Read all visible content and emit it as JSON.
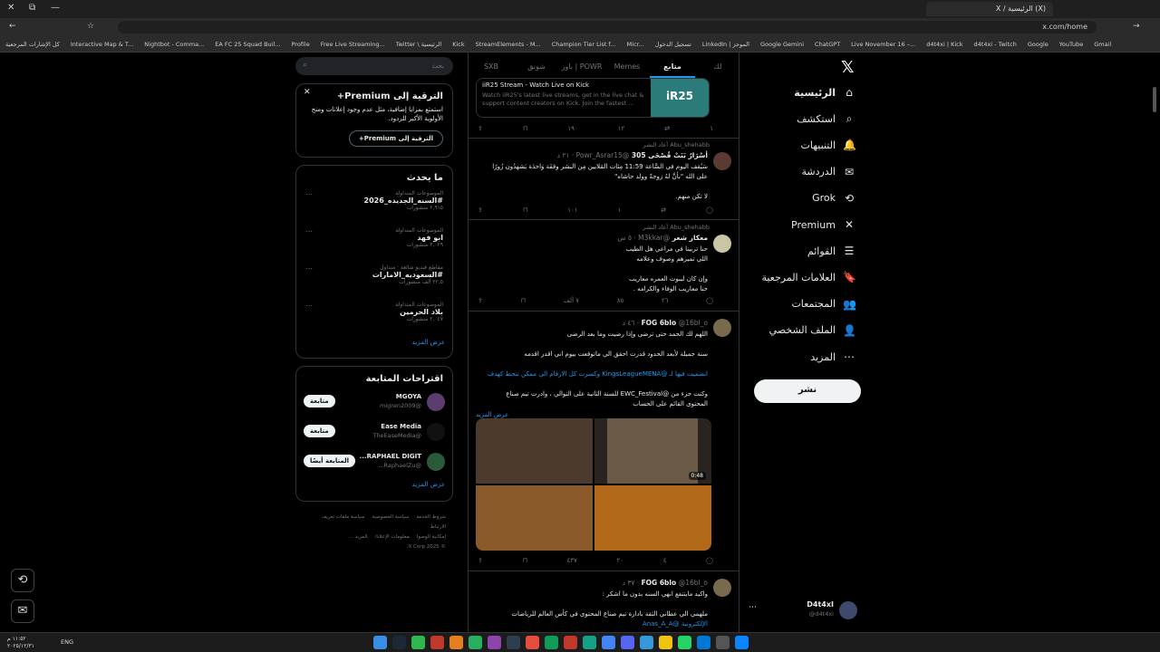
{
  "browser": {
    "tab_title": "(X) الرئيسية / X",
    "address": "x.com/home",
    "bookmarks": [
      "كل الإشارات المرجعية",
      "Interactive Map & T...",
      "Nightbot - Comma...",
      "EA FC 25 Squad Buil...",
      "Profile",
      "Free Live Streaming...",
      "Twitter \\ الرئيسية",
      "Kick",
      "StreamElements - M...",
      "Champion Tier List f...",
      "Micr...",
      "تسجيل الدخول",
      "LinkedIn | الموجز",
      "Google Gemini",
      "ChatGPT",
      "Live November 16 –...",
      "d4t4xi | Kick",
      "d4t4xi - Twitch",
      "Google",
      "YouTube",
      "Gmail"
    ]
  },
  "nav": {
    "items": [
      {
        "label": "الرئيسية",
        "icon": "home-icon",
        "glyph": "⌂"
      },
      {
        "label": "استكشف",
        "icon": "search-icon",
        "glyph": "⌕"
      },
      {
        "label": "التنبيهات",
        "icon": "bell-icon",
        "glyph": "🔔"
      },
      {
        "label": "الدردشة",
        "icon": "mail-icon",
        "glyph": "✉"
      },
      {
        "label": "Grok",
        "icon": "grok-icon",
        "glyph": "⟲"
      },
      {
        "label": "Premium",
        "icon": "x-premium-icon",
        "glyph": "✕"
      },
      {
        "label": "القوائم",
        "icon": "list-icon",
        "glyph": "☰"
      },
      {
        "label": "العلامات المرجعية",
        "icon": "bookmark-icon",
        "glyph": "🔖"
      },
      {
        "label": "المجتمعات",
        "icon": "communities-icon",
        "glyph": "👥"
      },
      {
        "label": "الملف الشخصي",
        "icon": "profile-icon",
        "glyph": "👤"
      },
      {
        "label": "المزيد",
        "icon": "more-icon",
        "glyph": "⋯"
      }
    ],
    "post_button": "نشر",
    "profile": {
      "name": "D4t4xI",
      "handle": "@d4t4xi"
    }
  },
  "timeline": {
    "tabs": [
      "لك",
      "متابع",
      "Memes",
      "باور | POWR",
      "شونق",
      "SXB"
    ],
    "card": {
      "title": "iiR25 Stream - Watch Live on Kick",
      "desc": "Watch iiR25's latest live streams, get in the live chat & support content creators on Kick. Join the fastest ...",
      "thumb": "iR25"
    },
    "card_actions": [
      "١٩٠",
      "١٢",
      "١"
    ],
    "tweets": [
      {
        "retweeted_by": "Abu_shehabb أعاد النشر",
        "name": "أسْرَارٌ بَنَتْ قُصْحَى 305",
        "handle": "@Powr_Asrar15 · ٢١ د",
        "lines": [
          "سَيُقف اليوم في السَّاعة 11:59 مِئات المَلايين مِن البشر وقفَة وَاحدَة يَشهدُون زُورًا",
          "على الله \"بأنَّ لهُ زوجةً وولد حاشاه\"",
          "",
          "لا تكن منهم."
        ],
        "actions": [
          "١٠١",
          "١",
          ""
        ]
      },
      {
        "retweeted_by": "Abu_shehabb أعاد النشر",
        "name": "معكار شعر",
        "handle": "@M3kkar · ٥ س",
        "lines": [
          "حنا تربينا في مراعي هل الطيب",
          "اللي تميزهم وصوف وعلامه",
          "",
          "وإن كان ليبوت العمره معاريب",
          "حنا معاريب الوفاء والكرامه ."
        ],
        "actions": [
          "٢٦",
          "٨٥",
          "٧ ألف"
        ]
      },
      {
        "name": "FOG 6blo",
        "handle": "@16bl_o · ٤٦ د",
        "lines": [
          "اللهم لك الحمد حتى ترضى وإذا رضيت وما بعد الرضى",
          "",
          "سنة جميلة لأبعد الحدود قدرت احقق الي ماتوقعت بيوم اني اقدر اقدمه",
          "",
          "انضميت فيها لـ @KingsLeagueMENA وكسرت كل الارقام الي ممكن تنحط كهدف",
          "",
          "وكنت جزء من @EWC_Festival للسنة الثانية على التوالي ، وادرت تيم صناع",
          "المحتوى القائم على الحساب"
        ],
        "show_more": "عرض المزيد",
        "video_duration": "0:48",
        "actions": [
          "٤",
          "٢٠",
          "٤٣٧"
        ]
      },
      {
        "name": "FOG 6blo",
        "handle": "@16bl_o · ٣٧ د",
        "lines": [
          "واكيد مايتنفع انهي السنه بدون ما اشكر :",
          "",
          "ملهمي الي عطاني الثقة بادارة تيم صناع المحتوى في كأس العالم للرياضات",
          "الإلكترونية @Anas_A_A"
        ]
      }
    ]
  },
  "sidebar": {
    "search_placeholder": "بحث",
    "premium": {
      "title": "الترقية إلى Premium+",
      "text": "استمتع بمزايا إضافية، مثل عدم وجود إعلانات ومنح الأولوية الأكبر للردود.",
      "button": "الترقية إلى Premium+"
    },
    "trends_title": "ما يحدث",
    "trends": [
      {
        "cat": "الموضوعات المتداولة",
        "name": "#السنه_الجديده_2026",
        "count": "٢,٩١٥ منشورات"
      },
      {
        "cat": "الموضوعات المتداولة",
        "name": "ابو فهد",
        "count": "٣,٠٢٩ منشورات"
      },
      {
        "cat": "مقاطع فيديو شائعة · متداول",
        "name": "#السعوديه_الامارات",
        "count": "٢٢,٥ ألف منشورات"
      },
      {
        "cat": "الموضوعات المتداولة",
        "name": "بلاد الحرمين",
        "count": "٢,٠٤٧ منشورات"
      }
    ],
    "show_more": "عرض المزيد",
    "follow_title": "اقتراحات المتابعة",
    "follows": [
      {
        "name": "MGOYA",
        "handle": "@migren2009",
        "btn": "متابعة"
      },
      {
        "name": "Ease Media",
        "handle": "@TheEaseMedia",
        "btn": "متابعة"
      },
      {
        "name": "RAPHAEL DIGIT...",
        "handle": "@RaphaelZu...",
        "btn": "المتابعة أيضًا"
      }
    ],
    "footer": [
      "شروط الخدمة",
      "سياسة الخصوصية",
      "سياسة ملفات تعريف الارتباط",
      "إمكانية الوصول",
      "معلومات الإعلانات",
      "المزيد ...",
      "© 2025 X Corp."
    ]
  },
  "taskbar": {
    "time": "١١:٥٢ م",
    "date": "٢٠٢٥/١٢/٣١",
    "lang": "ENG"
  },
  "colors": {
    "accent": "#1d9bf0",
    "bg": "#000000",
    "border": "#2f3336",
    "muted": "#71767b"
  }
}
